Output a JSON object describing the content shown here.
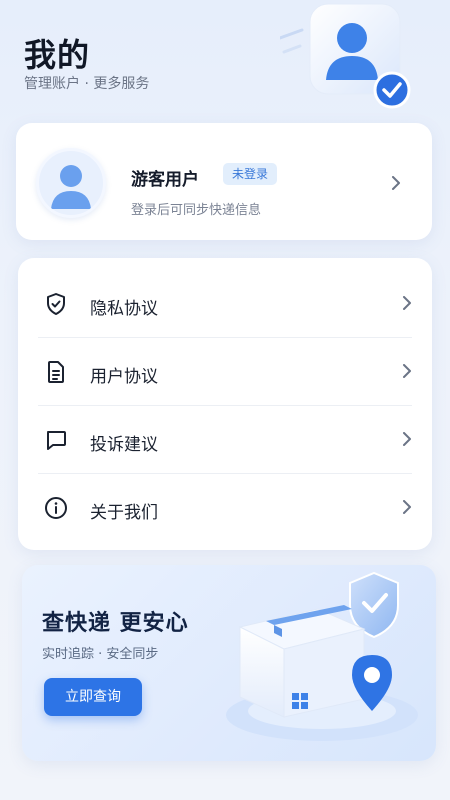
{
  "header": {
    "title": "我的",
    "subtitle": "管理账户 · 更多服务"
  },
  "user": {
    "name": "游客用户",
    "badge": "未登录",
    "hint": "登录后可同步快递信息"
  },
  "menu": [
    {
      "label": "隐私协议",
      "icon": "shield-check-icon"
    },
    {
      "label": "用户协议",
      "icon": "document-icon"
    },
    {
      "label": "投诉建议",
      "icon": "chat-bubble-icon"
    },
    {
      "label": "关于我们",
      "icon": "info-icon"
    }
  ],
  "promo": {
    "title": "查快递  更安心",
    "subtitle": "实时追踪 · 安全同步",
    "button": "立即查询"
  },
  "colors": {
    "accent": "#2d74e6",
    "badge_bg": "#e2eefc",
    "badge_text": "#3978d8"
  }
}
